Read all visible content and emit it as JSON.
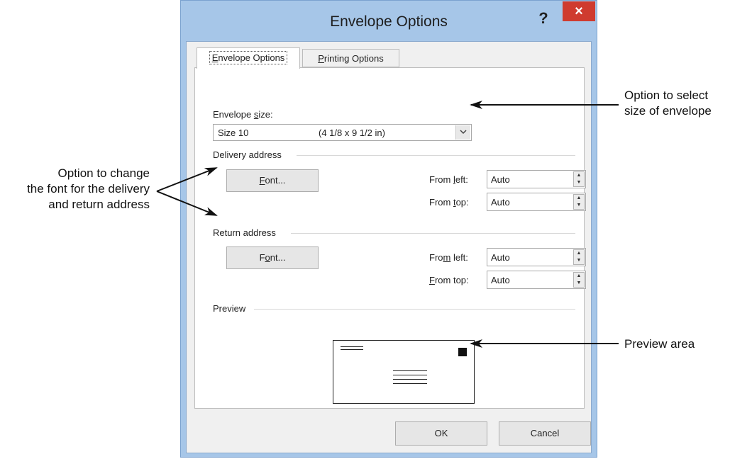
{
  "dialog": {
    "title": "Envelope Options",
    "help_glyph": "?",
    "close_glyph": "×"
  },
  "tabs": [
    {
      "label": "Envelope Options",
      "accel": "E",
      "rest": "nvelope Options",
      "selected": true
    },
    {
      "label": "Printing Options",
      "accel": "P",
      "rest": "rinting Options",
      "selected": false
    }
  ],
  "envelope_size": {
    "label_pre": "Envelope ",
    "label_accel": "s",
    "label_post": "ize:",
    "value_name": "Size 10",
    "value_dims": "(4 1/8 x 9 1/2 in)"
  },
  "delivery": {
    "heading": "Delivery address",
    "font_btn_pre": "",
    "font_btn_accel": "F",
    "font_btn_post": "ont...",
    "from_left_pre": "From ",
    "from_left_accel": "l",
    "from_left_post": "eft:",
    "from_left_value": "Auto",
    "from_top_pre": "From ",
    "from_top_accel": "t",
    "from_top_post": "op:",
    "from_top_value": "Auto"
  },
  "return": {
    "heading": "Return address",
    "font_btn_pre": "F",
    "font_btn_accel": "o",
    "font_btn_post": "nt...",
    "from_left_pre": "Fro",
    "from_left_accel": "m",
    "from_left_post": " left:",
    "from_left_value": "Auto",
    "from_top_pre": "",
    "from_top_accel": "F",
    "from_top_post": "rom top:",
    "from_top_value": "Auto"
  },
  "preview": {
    "heading": "Preview"
  },
  "buttons": {
    "ok": "OK",
    "cancel": "Cancel"
  },
  "callouts": {
    "font_line1": "Option to change",
    "font_line2": "the font for the delivery",
    "font_line3": "and return address",
    "size_line1": "Option to select",
    "size_line2": "size of envelope",
    "preview": "Preview area"
  },
  "colors": {
    "dialog_frame": "#a6c6e8",
    "close_button": "#cf3b2f"
  },
  "icons": {
    "dropdown": "chevron-down-icon",
    "spin_up": "spin-up-icon",
    "spin_down": "spin-down-icon"
  }
}
